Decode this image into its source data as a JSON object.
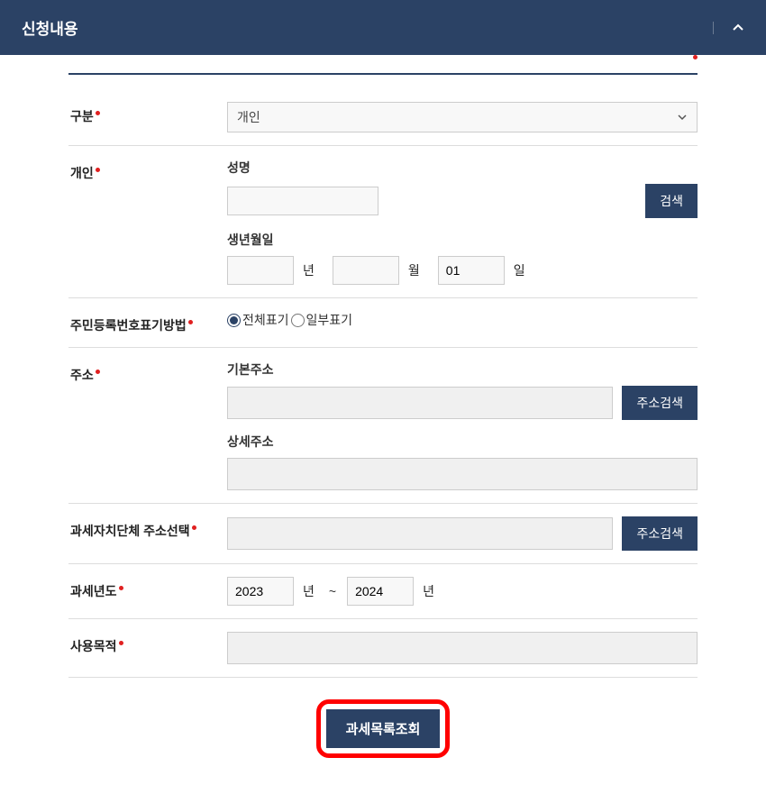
{
  "header": {
    "title": "신청내용"
  },
  "form": {
    "category": {
      "label": "구분",
      "value": "개인"
    },
    "individual": {
      "label": "개인",
      "name_label": "성명",
      "name_value": "",
      "search_button": "검색",
      "birth_label": "생년월일",
      "year_value": "",
      "year_unit": "년",
      "month_value": "",
      "month_unit": "월",
      "day_value": "01",
      "day_unit": "일"
    },
    "rrn_display": {
      "label": "주민등록번호표기방법",
      "option_full": "전체표기",
      "option_partial": "일부표기",
      "selected": "full"
    },
    "address": {
      "label": "주소",
      "base_label": "기본주소",
      "base_value": "",
      "search_button": "주소검색",
      "detail_label": "상세주소",
      "detail_value": ""
    },
    "tax_authority": {
      "label": "과세자치단체 주소선택",
      "value": "",
      "search_button": "주소검색"
    },
    "tax_year": {
      "label": "과세년도",
      "from_value": "2023",
      "from_unit": "년",
      "separator": "~",
      "to_value": "2024",
      "to_unit": "년"
    },
    "purpose": {
      "label": "사용목적",
      "value": ""
    }
  },
  "actions": {
    "inquiry_button": "과세목록조회"
  }
}
